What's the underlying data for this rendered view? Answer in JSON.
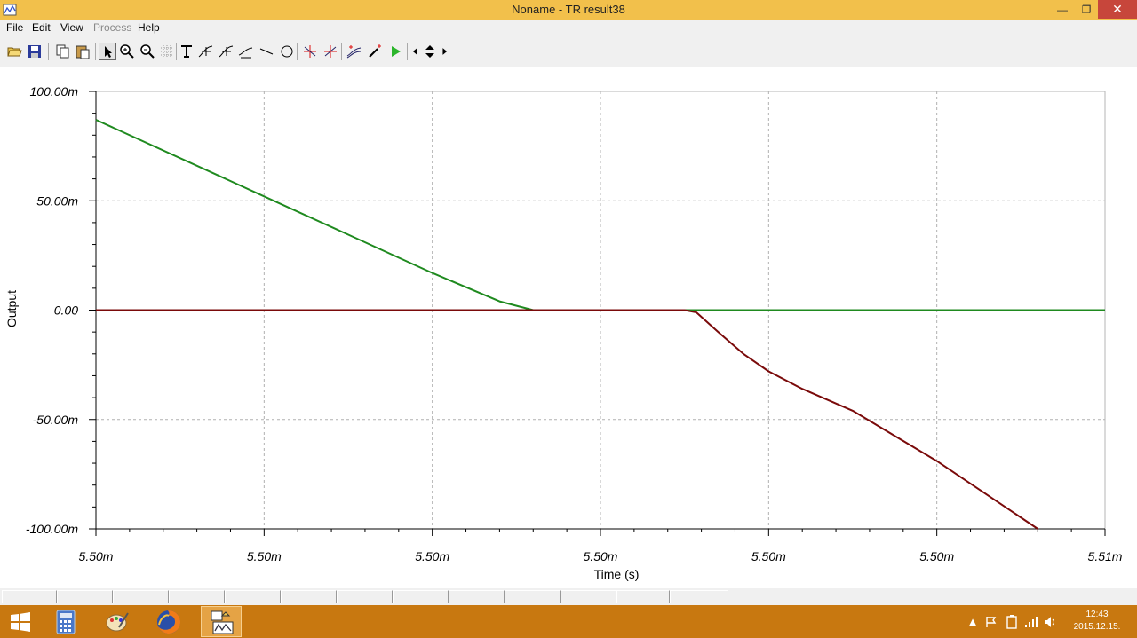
{
  "window": {
    "title": "Noname - TR result38",
    "minimize_glyph": "—",
    "maximize_glyph": "❐",
    "close_glyph": "✕"
  },
  "menu": [
    "File",
    "Edit",
    "View",
    "Process",
    "Help"
  ],
  "toolbar_icons": [
    "open-folder-icon",
    "save-icon",
    "copy-icon",
    "paste-icon",
    "pointer-icon",
    "zoom-in-icon",
    "zoom-100-icon",
    "grid-icon",
    "text-icon",
    "cursor-a-icon",
    "cursor-b-icon",
    "cursor-ab-icon",
    "line-icon",
    "ellipse-icon",
    "marker-a-icon",
    "marker-b-icon",
    "add-curve-icon",
    "pen-icon",
    "run-icon",
    "arrow-left-icon",
    "arrow-updown-icon",
    "arrow-right-icon"
  ],
  "chart_data": {
    "type": "line",
    "xlabel": "Time (s)",
    "ylabel": "Output",
    "x_tick_labels": [
      "5.50m",
      "5.50m",
      "5.50m",
      "5.50m",
      "5.50m",
      "5.50m",
      "5.51m"
    ],
    "y_tick_labels": [
      "100.00m",
      "50.00m",
      "0.00",
      "-50.00m",
      "-100.00m"
    ],
    "ylim": [
      -0.1,
      0.1
    ],
    "x_domain": [
      0,
      6
    ],
    "grid": true,
    "series": [
      {
        "color": "#1f8a1f",
        "points": [
          [
            0,
            0.087
          ],
          [
            1,
            0.052
          ],
          [
            2,
            0.017
          ],
          [
            2.4,
            0.004
          ],
          [
            2.6,
            0.0
          ],
          [
            6,
            0.0
          ]
        ]
      },
      {
        "color": "#7a0a0a",
        "points": [
          [
            0,
            0.0
          ],
          [
            3.5,
            0.0
          ],
          [
            3.57,
            -0.001
          ],
          [
            3.7,
            -0.01
          ],
          [
            3.85,
            -0.02
          ],
          [
            4.0,
            -0.028
          ],
          [
            4.2,
            -0.036
          ],
          [
            4.5,
            -0.046
          ],
          [
            5.0,
            -0.069
          ],
          [
            5.6,
            -0.1
          ]
        ]
      }
    ]
  },
  "taskbar": {
    "apps": [
      "windows-start-icon",
      "calculator-icon",
      "paint-icon",
      "firefox-icon",
      "tina-app-icon"
    ],
    "clock_time": "12:43",
    "clock_date": "2015.12.15."
  },
  "colors": {
    "titlebar": "#f2c04b",
    "taskbar": "#c87810",
    "close_button": "#c7463b"
  }
}
